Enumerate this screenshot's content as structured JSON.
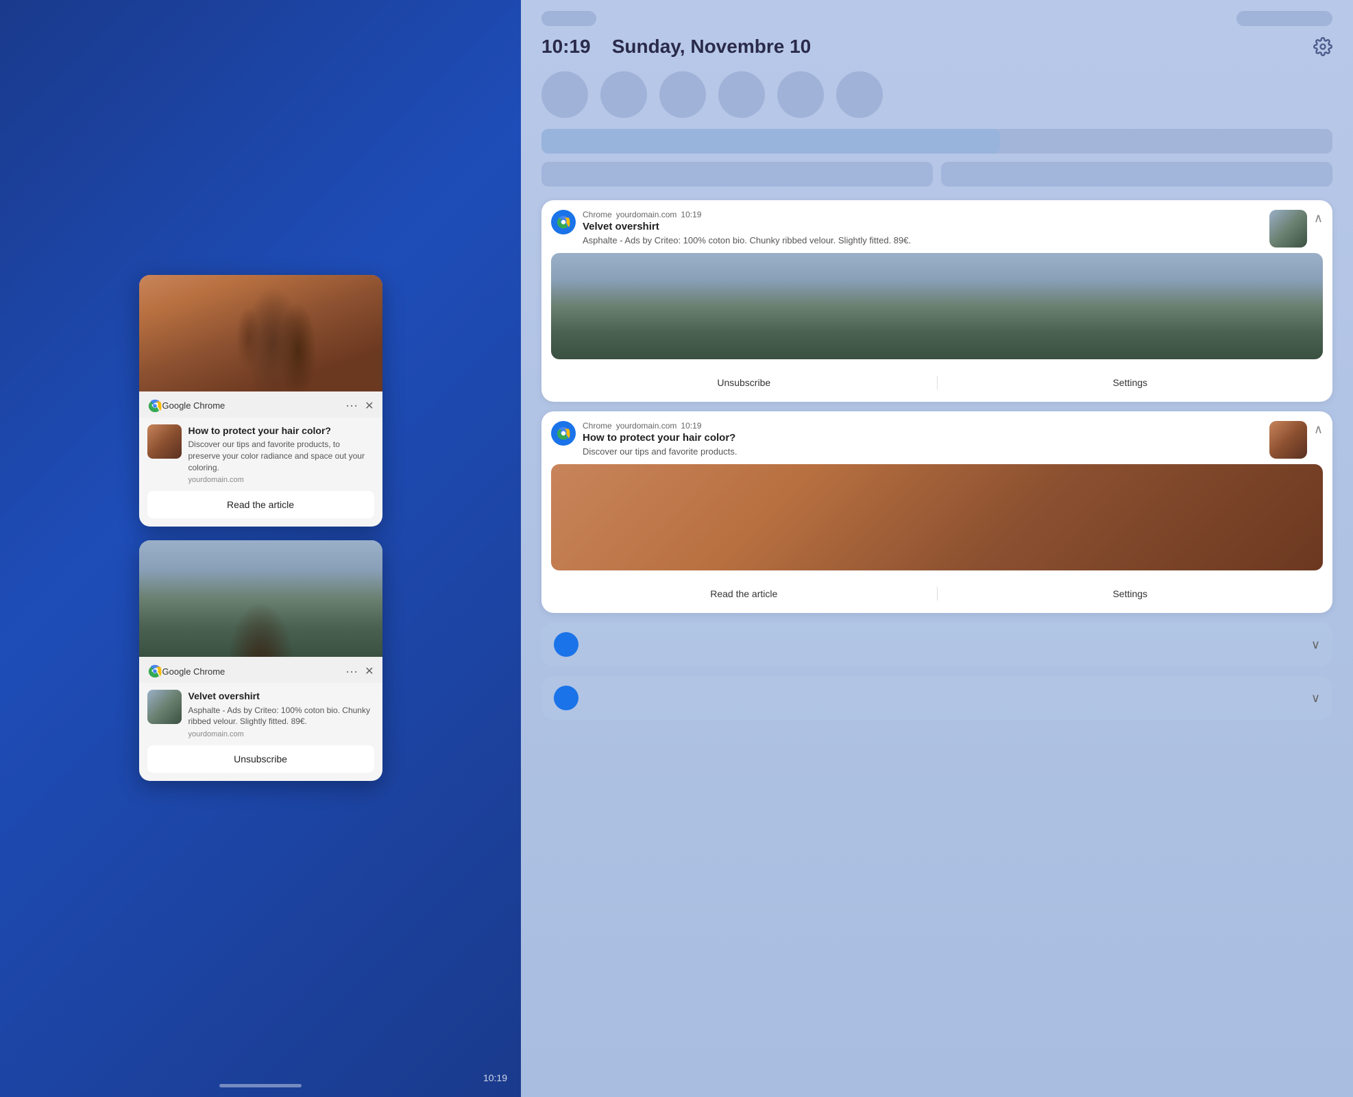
{
  "left": {
    "card1": {
      "browser": "Google Chrome",
      "title": "How to protect your hair color?",
      "description": "Discover our tips and favorite products, to preserve your color radiance and space out your coloring.",
      "domain": "yourdomain.com",
      "action": "Read the article"
    },
    "card2": {
      "browser": "Google Chrome",
      "title": "Velvet overshirt",
      "description": "Asphalte - Ads by Criteo: 100% coton bio. Chunky ribbed velour. Slightly fitted. 89€.",
      "domain": "yourdomain.com",
      "action": "Unsubscribe"
    },
    "time": "10:19"
  },
  "right": {
    "status": {
      "time": "10:19",
      "date": "Sunday, Novembre 10"
    },
    "notif1": {
      "source": "Chrome",
      "domain": "yourdomain.com",
      "time": "10:19",
      "title": "Velvet overshirt",
      "description": "Asphalte - Ads by Criteo: 100% coton bio. Chunky ribbed velour. Slightly fitted. 89€.",
      "action1": "Unsubscribe",
      "action2": "Settings"
    },
    "notif2": {
      "source": "Chrome",
      "domain": "yourdomain.com",
      "time": "10:19",
      "title": "How to protect your hair color?",
      "description": "Discover our tips and favorite products.",
      "action1": "Read the article",
      "action2": "Settings"
    },
    "progress_fill": "58%",
    "icons": {
      "gear": "⚙",
      "collapse": "∧",
      "expand": "∨"
    }
  }
}
